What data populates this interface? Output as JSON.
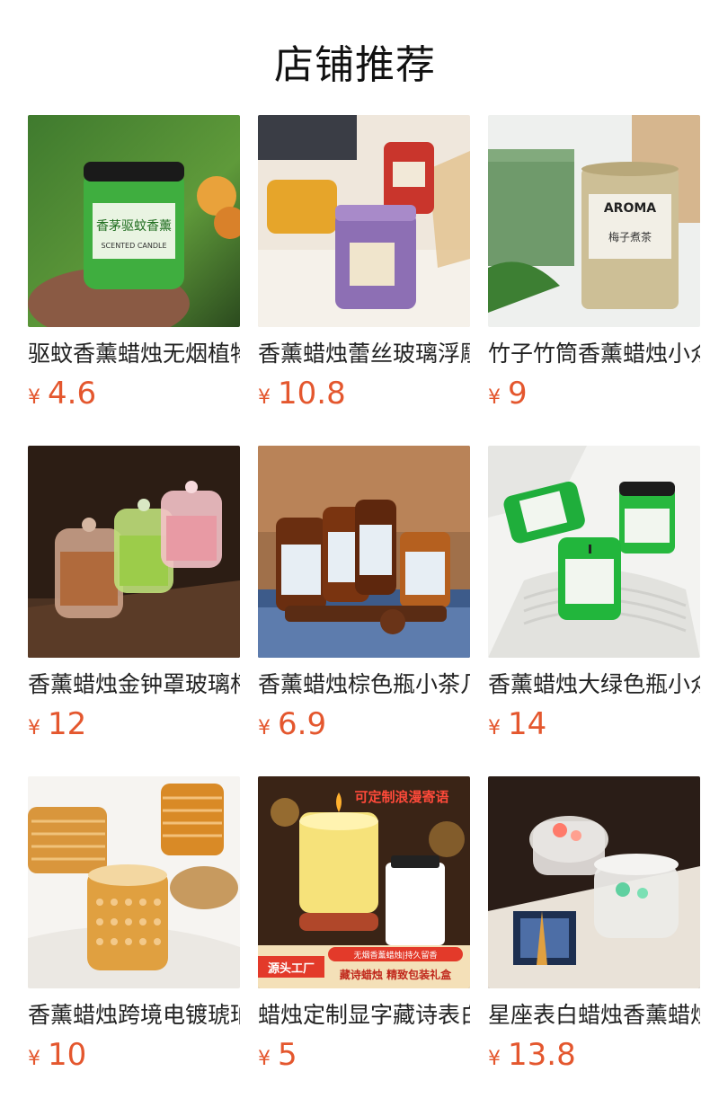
{
  "header": {
    "title": "店铺推荐"
  },
  "currency_symbol": "¥",
  "accent_color": "#e4572e",
  "products": [
    {
      "name": "驱蚊香薰蜡烛无烟植物精油",
      "price": "4.6",
      "image": "green-jar-citronella-candle",
      "image_text": {
        "label": "香茅驱蚊香薰",
        "sub": "SCENTED CANDLE"
      }
    },
    {
      "name": "香薰蜡烛蕾丝玻璃浮雕杯",
      "price": "10.8",
      "image": "purple-lace-glass-candle"
    },
    {
      "name": "竹子竹筒香薰蜡烛小众",
      "price": "9",
      "image": "bamboo-tube-aroma-candle",
      "image_text": {
        "label": "AROMA",
        "sub": "梅子煮茶"
      }
    },
    {
      "name": "香薰蜡烛金钟罩玻璃杯",
      "price": "12",
      "image": "bell-jar-glass-candles"
    },
    {
      "name": "香薰蜡烛棕色瓶小茶几",
      "price": "6.9",
      "image": "amber-bottle-candles"
    },
    {
      "name": "香薰蜡烛大绿色瓶小众",
      "price": "14",
      "image": "green-bottle-candles"
    },
    {
      "name": "香薰蜡烛跨境电镀琥珀杯",
      "price": "10",
      "image": "amber-hobnail-glass-candles"
    },
    {
      "name": "蜡烛定制显字藏诗表白",
      "price": "5",
      "image": "custom-text-candle-gift-box",
      "image_text": {
        "top_banner": "可定制浪漫寄语",
        "badge": "源头工厂",
        "line1": "无烟香薰蜡烛|持久留香",
        "line2": "藏诗蜡烛  精致包装礼盒"
      }
    },
    {
      "name": "星座表白蜡烛香薰蜡烛",
      "price": "13.8",
      "image": "constellation-crystal-candles"
    }
  ]
}
